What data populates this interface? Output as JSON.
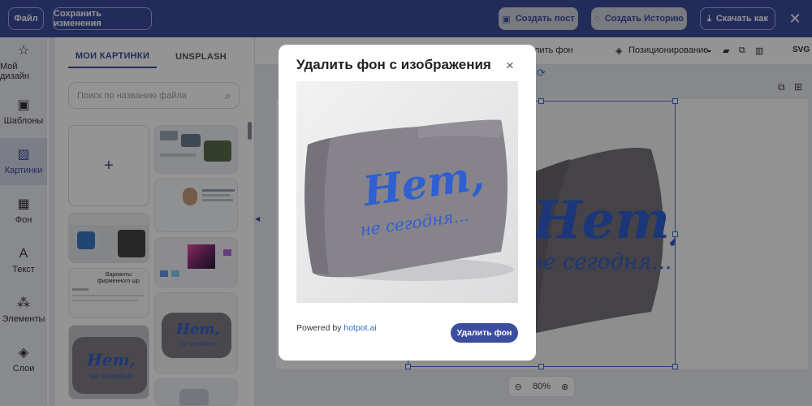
{
  "topbar": {
    "file_label": "Файл",
    "save_label": "Сохранить изменения",
    "create_post_label": "Создать пост",
    "create_story_label": "Создать Историю",
    "download_label": "Скачать как",
    "close_glyph": "✕"
  },
  "rail": {
    "items": [
      {
        "label": "Мой дизайн",
        "icon": "star-icon",
        "glyph": "☆"
      },
      {
        "label": "Шаблоны",
        "icon": "template-icon",
        "glyph": "▣"
      },
      {
        "label": "Картинки",
        "icon": "image-icon",
        "glyph": "▨"
      },
      {
        "label": "Фон",
        "icon": "background-icon",
        "glyph": "▦"
      },
      {
        "label": "Текст",
        "icon": "text-icon",
        "glyph": "A"
      },
      {
        "label": "Элементы",
        "icon": "shapes-icon",
        "glyph": "⁂"
      },
      {
        "label": "Слои",
        "icon": "layers-icon",
        "glyph": "◈"
      }
    ]
  },
  "panel": {
    "tab_my_images": "МОИ КАРТИНКИ",
    "tab_unsplash": "UNSPLASH",
    "search_placeholder": "Поиск по названию файла",
    "add_tile_glyph": "+",
    "thumb_variants_title": "Варианты фирменного шр",
    "pillow_text_big": "Нет,",
    "pillow_text_small": "не сегодня"
  },
  "toolbar2": {
    "remove_bg_label": "лить фон",
    "positioning_label": "Позиционирование",
    "svg_label": "SVG"
  },
  "canvas": {
    "zoom_value": "80%",
    "pillow_text_big": "Нет,",
    "pillow_text_small": "не сегодня..."
  },
  "modal": {
    "title": "Удалить фон с изображения",
    "close_glyph": "×",
    "powered_prefix": "Powered by",
    "powered_link": "hotpot.ai",
    "action_label": "Удалить фон",
    "pillow_text_big": "Нет,",
    "pillow_text_small": "не сегодня..."
  },
  "colors": {
    "brand": "#3c4d9e",
    "accent_text": "#2f5fd0",
    "pillow": "#807d85"
  }
}
